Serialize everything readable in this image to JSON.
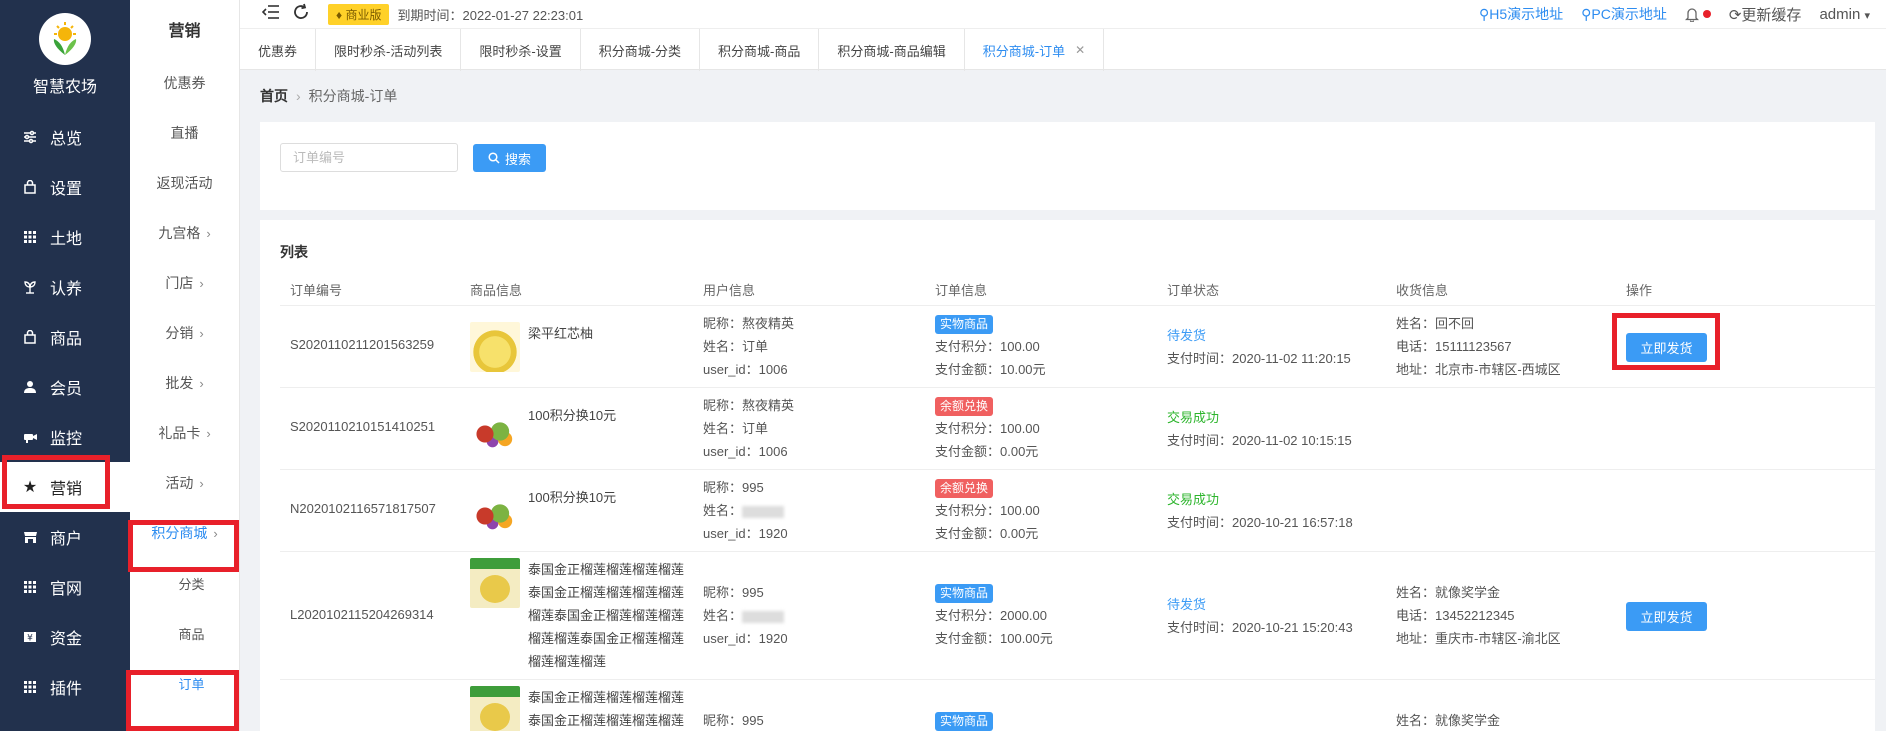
{
  "app": {
    "name": "智慧农场"
  },
  "nav1": [
    {
      "label": "总览",
      "icon": "sliders-icon"
    },
    {
      "label": "设置",
      "icon": "bag-icon"
    },
    {
      "label": "土地",
      "icon": "grid-icon"
    },
    {
      "label": "认养",
      "icon": "sprout-icon"
    },
    {
      "label": "商品",
      "icon": "bag-icon"
    },
    {
      "label": "会员",
      "icon": "user-icon"
    },
    {
      "label": "监控",
      "icon": "camera-icon"
    },
    {
      "label": "营销",
      "icon": "star-icon"
    },
    {
      "label": "商户",
      "icon": "store-icon"
    },
    {
      "label": "官网",
      "icon": "grid-icon"
    },
    {
      "label": "资金",
      "icon": "money-icon"
    },
    {
      "label": "插件",
      "icon": "grid-icon"
    }
  ],
  "nav2": {
    "title": "营销",
    "items": [
      "优惠券",
      "直播",
      "返现活动",
      "九宫格",
      "门店",
      "分销",
      "批发",
      "礼品卡",
      "活动",
      "积分商城"
    ],
    "subs": [
      "分类",
      "商品",
      "订单"
    ]
  },
  "header": {
    "badge": "商业版",
    "expire": "到期时间：2022-01-27 22:23:01",
    "h5": "H5演示地址",
    "pc": "PC演示地址",
    "cache": "更新缓存",
    "user": "admin"
  },
  "tabs": [
    "优惠券",
    "限时秒杀-活动列表",
    "限时秒杀-设置",
    "积分商城-分类",
    "积分商城-商品",
    "积分商城-商品编辑",
    "积分商城-订单"
  ],
  "breadcrumb": {
    "home": "首页",
    "current": "积分商城-订单"
  },
  "search": {
    "placeholder": "订单编号",
    "button": "搜索"
  },
  "list": {
    "title": "列表",
    "headers": [
      "订单编号",
      "商品信息",
      "用户信息",
      "订单信息",
      "订单状态",
      "收货信息",
      "操作"
    ],
    "ship_label": "立即发货",
    "rows": [
      {
        "order": "S2020110211201563259",
        "product": "梁平红芯柚",
        "nick": "昵称：熬夜精英",
        "name": "姓名：订单",
        "uid": "user_id：1006",
        "tag": "实物商品",
        "points": "支付积分：100.00",
        "amount": "支付金额：10.00元",
        "status": "待发货",
        "time": "支付时间：2020-11-02 11:20:15",
        "rname": "姓名：回不回",
        "phone": "电话：15111123567",
        "addr": "地址：北京市-市辖区-西城区"
      },
      {
        "order": "S2020110210151410251",
        "product": "100积分换10元",
        "nick": "昵称：熬夜精英",
        "name": "姓名：订单",
        "uid": "user_id：1006",
        "tag": "余额兑换",
        "points": "支付积分：100.00",
        "amount": "支付金额：0.00元",
        "status": "交易成功",
        "time": "支付时间：2020-11-02 10:15:15"
      },
      {
        "order": "N2020102116571817507",
        "product": "100积分换10元",
        "nick": "昵称：995",
        "name": "姓名：",
        "uid": "user_id：1920",
        "tag": "余额兑换",
        "points": "支付积分：100.00",
        "amount": "支付金额：0.00元",
        "status": "交易成功",
        "time": "支付时间：2020-10-21 16:57:18"
      },
      {
        "order": "L2020102115204269314",
        "product": "泰国金正榴莲榴莲榴莲榴莲泰国金正榴莲榴莲榴莲榴莲榴莲泰国金正榴莲榴莲榴莲榴莲榴莲泰国金正榴莲榴莲榴莲榴莲榴莲",
        "nick": "昵称：995",
        "name": "姓名：",
        "uid": "user_id：1920",
        "tag": "实物商品",
        "points": "支付积分：2000.00",
        "amount": "支付金额：100.00元",
        "status": "待发货",
        "time": "支付时间：2020-10-21 15:20:43",
        "rname": "姓名：就像奖学金",
        "phone": "电话：13452212345",
        "addr": "地址：重庆市-市辖区-渝北区"
      },
      {
        "product": "泰国金正榴莲榴莲榴莲榴莲泰国金正榴莲榴莲榴莲榴莲",
        "nick": "昵称：995",
        "tag": "实物商品",
        "rname": "姓名：就像奖学金"
      }
    ]
  },
  "colors": {
    "sidebar": "#22314d",
    "accent": "#3b9bf5",
    "highlight": "#e8202a",
    "success": "#2db52d",
    "tag_red": "#f06060"
  }
}
